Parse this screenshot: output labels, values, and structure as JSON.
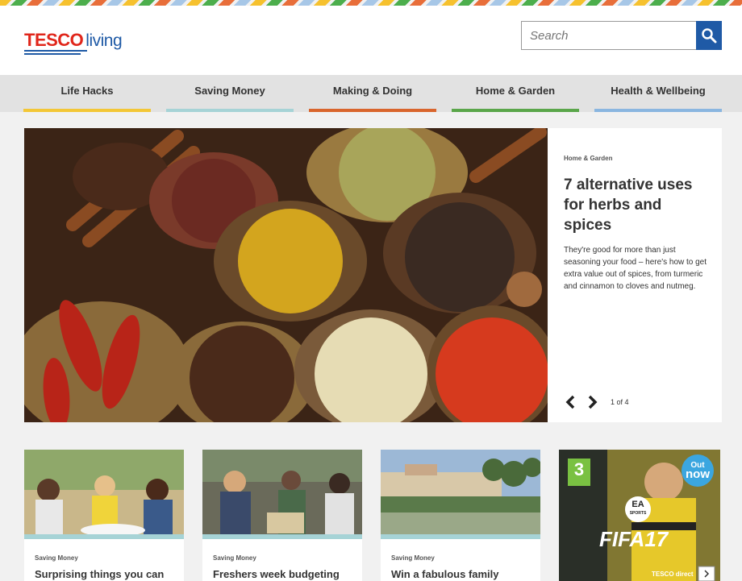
{
  "brand": {
    "name_part1": "TESCO",
    "name_part2": "living"
  },
  "search": {
    "placeholder": "Search"
  },
  "nav": [
    {
      "label": "Life Hacks",
      "color": "#f3c737"
    },
    {
      "label": "Saving Money",
      "color": "#a6d3d6"
    },
    {
      "label": "Making & Doing",
      "color": "#d9652d"
    },
    {
      "label": "Home & Garden",
      "color": "#5aa64a"
    },
    {
      "label": "Health & Wellbeing",
      "color": "#8ab6e0"
    }
  ],
  "hero": {
    "category": "Home & Garden",
    "title": "7 alternative uses for herbs and spices",
    "description": "They're good for more than just seasoning your food – here's how to get extra value out of spices, from turmeric and cinnamon to cloves and nutmeg.",
    "pager": "1 of 4"
  },
  "cards": [
    {
      "category": "Saving Money",
      "title": "Surprising things you can"
    },
    {
      "category": "Saving Money",
      "title": "Freshers week budgeting"
    },
    {
      "category": "Saving Money",
      "title": "Win a fabulous family"
    }
  ],
  "ad": {
    "badge_line1": "Out",
    "badge_line2": "now",
    "rating": "3",
    "ea": "EA",
    "sports": "SPORTS",
    "game": "FIFA",
    "game_num": "17",
    "brand": "TESCO direct"
  }
}
